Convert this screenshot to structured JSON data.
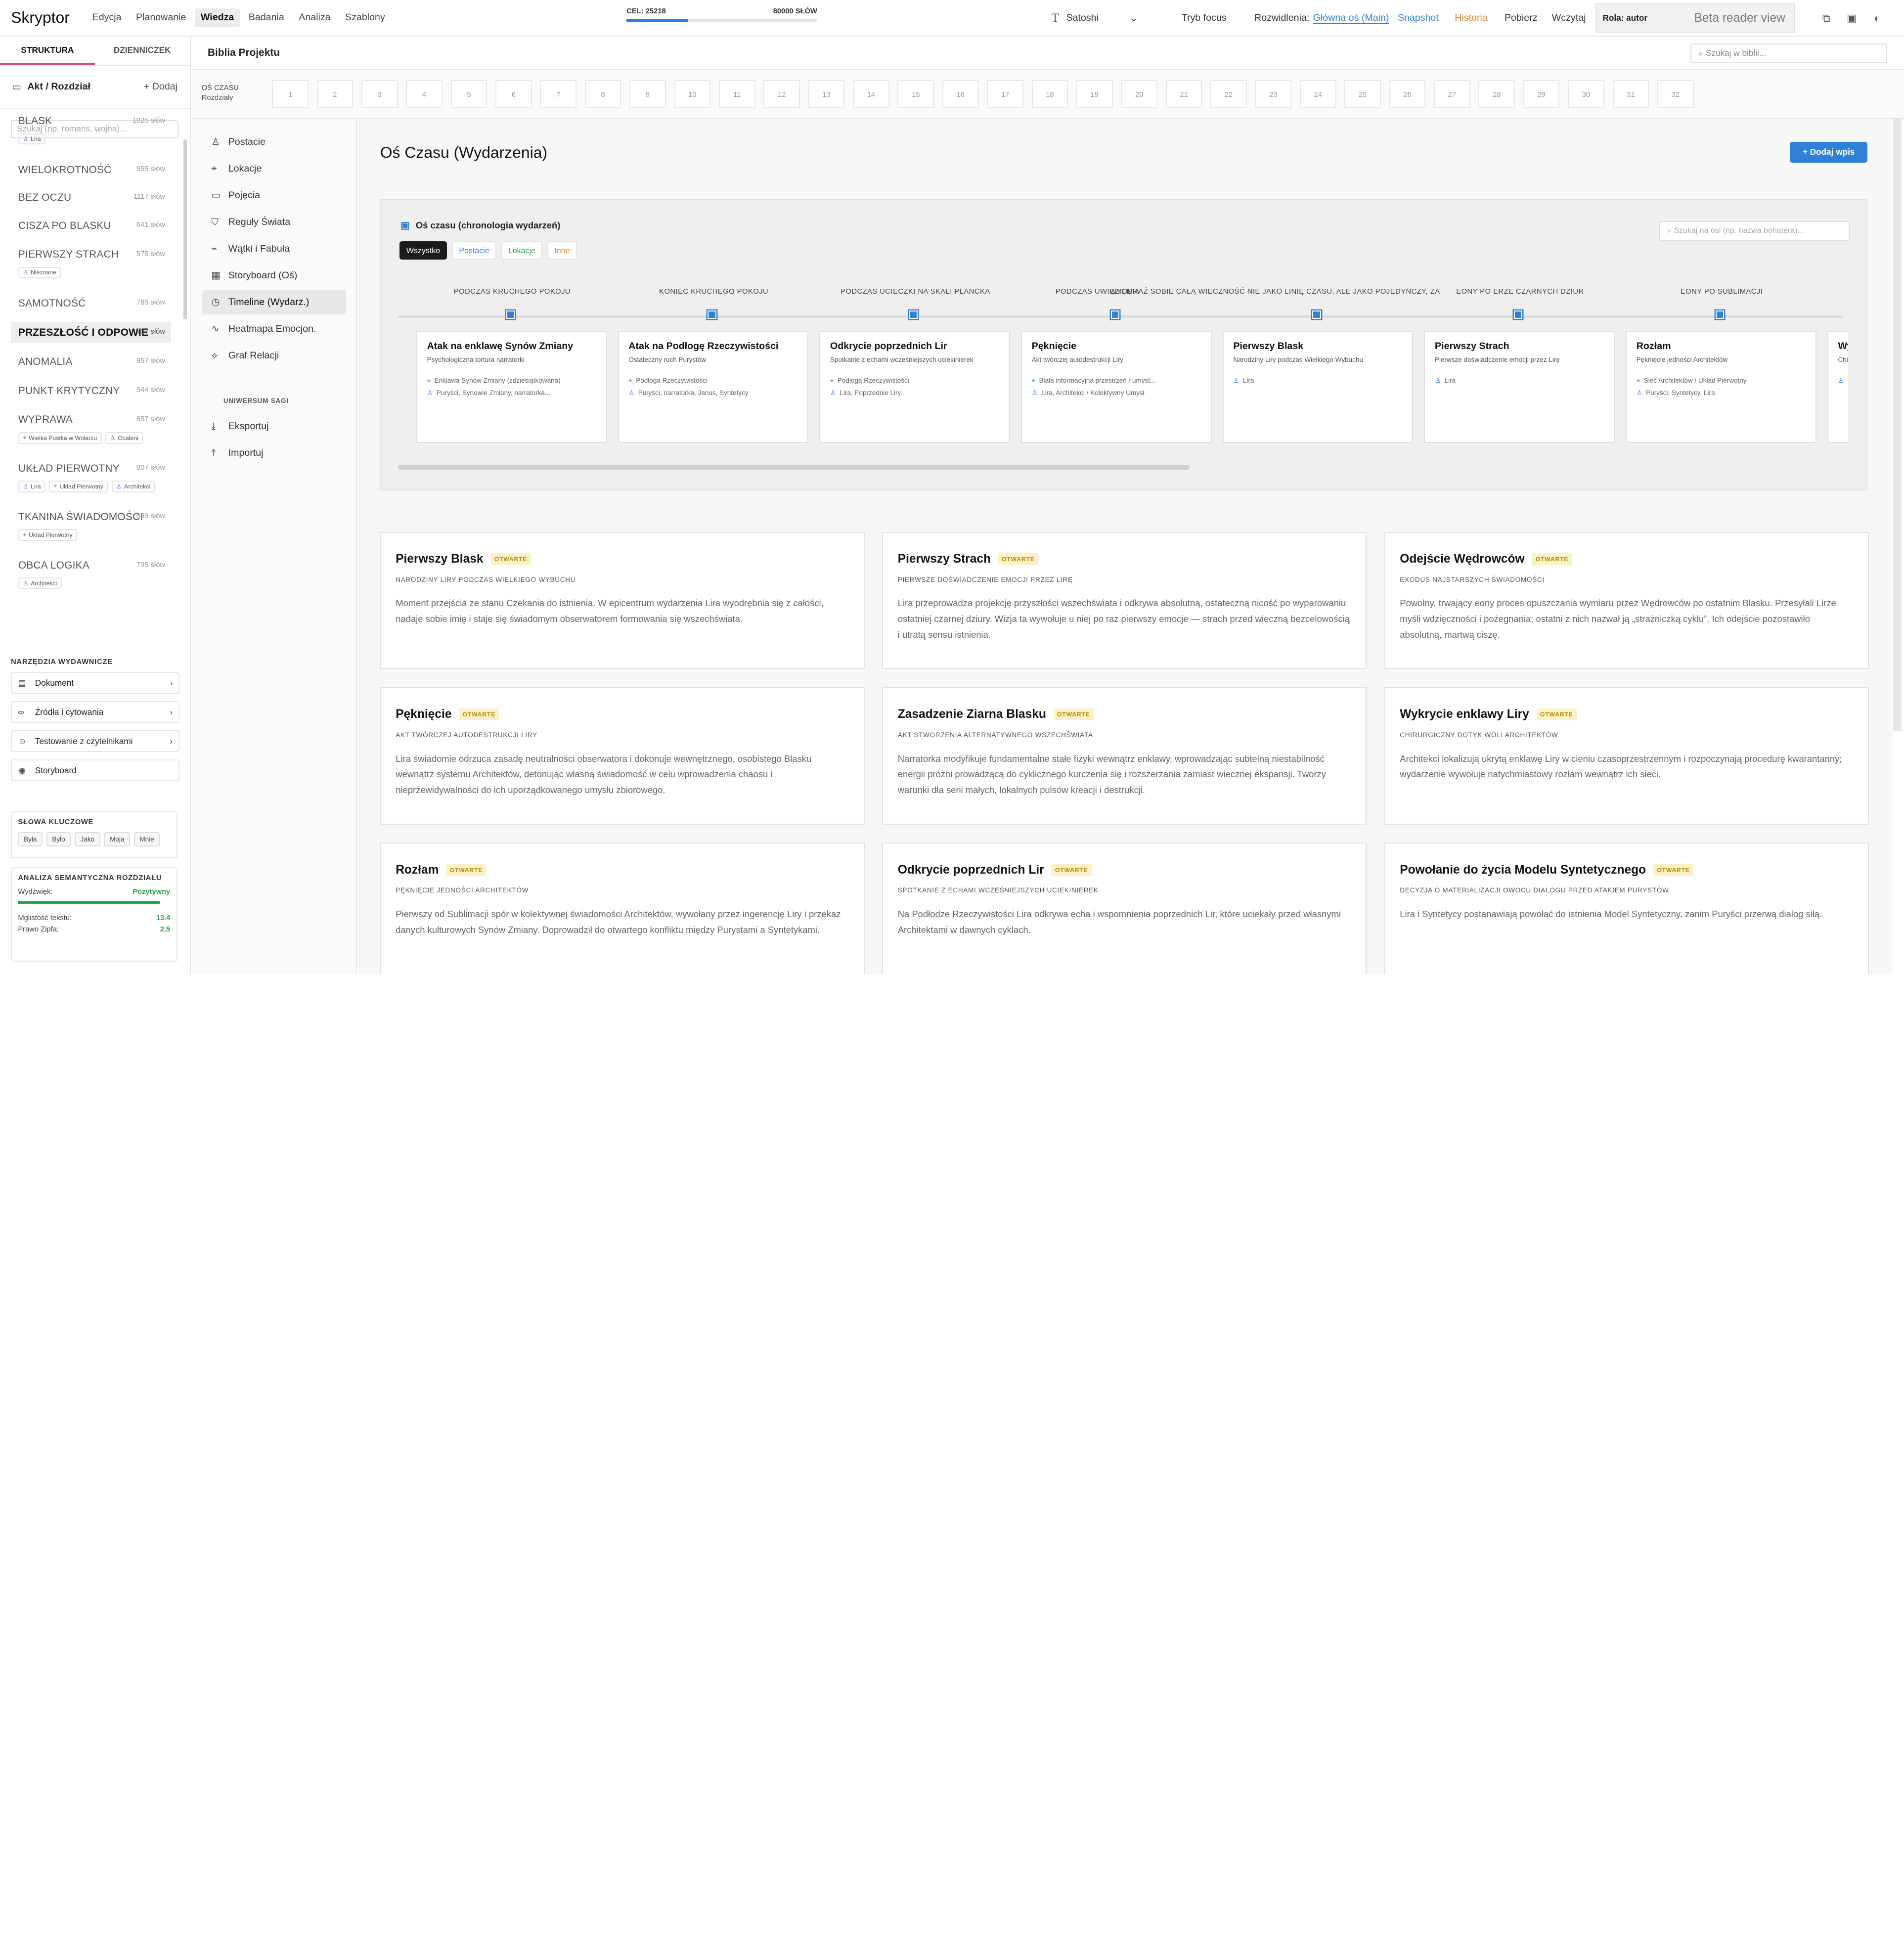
{
  "app": {
    "logo": "Skryptor"
  },
  "menu": [
    "Edycja",
    "Planowanie",
    "Wiedza",
    "Badania",
    "Analiza",
    "Szablony"
  ],
  "menu_active": 2,
  "goal": {
    "label": "CEL: 25218",
    "target": "80000 SŁÓW",
    "progress": 0.32
  },
  "toolbar": {
    "font": "Satoshi",
    "focus": "Tryb focus",
    "branches_label": "Rozwidlenia:",
    "branch": "Główna oś (Main)",
    "snapshot": "Snapshot",
    "history": "Historia",
    "download": "Pobierz",
    "load": "Wczytaj",
    "role": "Rola: autor",
    "beta": "Beta reader view"
  },
  "colors": {
    "accent": "#2f80d8",
    "snapshot": "#2f80d8",
    "history": "#e0852d",
    "tab_underline": "#d44a7a",
    "green": "#2ca24f"
  },
  "sidebar": {
    "tabs": [
      "STRUKTURA",
      "DZIENNICZEK"
    ],
    "act_label": "Akt / Rozdział",
    "add_label": "Dodaj",
    "search_placeholder": "Szukaj (np. romans, wojna)...",
    "chapters": [
      {
        "title": "BLASK",
        "words": "1025 słów",
        "tags": [
          {
            "t": "p",
            "l": "Lira"
          }
        ]
      },
      {
        "title": "WIELOKROTNOŚĆ",
        "words": "955 słów",
        "tags": []
      },
      {
        "title": "BEZ OCZU",
        "words": "1117 słów",
        "tags": []
      },
      {
        "title": "CISZA PO BLASKU",
        "words": "641 słów",
        "tags": []
      },
      {
        "title": "PIERWSZY STRACH",
        "words": "575 słów",
        "tags": [
          {
            "t": "p",
            "l": "Nieznane"
          }
        ]
      },
      {
        "title": "SAMOTNOŚĆ",
        "words": "785 słów",
        "tags": []
      },
      {
        "title": "PRZESZŁOŚĆ I ODPOWIE",
        "words": "757 słów",
        "tags": [],
        "selected": true
      },
      {
        "title": "ANOMALIA",
        "words": "957 słów",
        "tags": []
      },
      {
        "title": "PUNKT KRYTYCZNY",
        "words": "544 słów",
        "tags": []
      },
      {
        "title": "WYPRAWA",
        "words": "857 słów",
        "tags": [
          {
            "t": "l",
            "l": "Wielka Pustka w Wolarzu"
          },
          {
            "t": "p",
            "l": "Ocaleni"
          }
        ]
      },
      {
        "title": "UKŁAD PIERWOTNY",
        "words": "807 słów",
        "tags": [
          {
            "t": "p",
            "l": "Lira"
          },
          {
            "t": "l",
            "l": "Układ Pierwotny"
          },
          {
            "t": "p",
            "l": "Architekci"
          }
        ]
      },
      {
        "title": "TKANINA ŚWIADOMOŚCI",
        "words": "699 słów",
        "tags": [
          {
            "t": "l",
            "l": "Układ Pierwotny"
          }
        ]
      },
      {
        "title": "OBCA LOGIKA",
        "words": "795 słów",
        "tags": [
          {
            "t": "p",
            "l": "Architekci"
          }
        ]
      }
    ],
    "tools_title": "NARZĘDZIA WYDAWNICZE",
    "tools": [
      "Dokument",
      "Źródła i cytowania",
      "Testowanie z czytelnikami",
      "Storyboard"
    ],
    "keywords_title": "SŁOWA KLUCZOWE",
    "keywords": [
      "Była",
      "Było",
      "Jako",
      "Moja",
      "Mnie"
    ],
    "semantic": {
      "title": "ANALIZA SEMANTYCZNA ROZDZIAŁU",
      "tone_label": "Wydźwięk:",
      "tone": "Pozytywny",
      "tone_level": 0.93,
      "fog_label": "Mglistość tekstu:",
      "fog": "13.4",
      "zipf_label": "Prawo Zipfa:",
      "zipf": "2.5"
    }
  },
  "bible": {
    "title": "Biblia Projektu",
    "search_placeholder": "Szukaj w biblii..."
  },
  "strip": {
    "label": "OŚ CZASU",
    "sub": "Rozdziały",
    "numbers": [
      "1",
      "2",
      "3",
      "4",
      "5",
      "6",
      "7",
      "8",
      "9",
      "10",
      "11",
      "12",
      "13",
      "14",
      "15",
      "16",
      "17",
      "18",
      "19",
      "20",
      "21",
      "22",
      "23",
      "24",
      "25",
      "26",
      "27",
      "28",
      "29",
      "30",
      "31",
      "32"
    ]
  },
  "nav": {
    "items": [
      "Postacie",
      "Lokacje",
      "Pojęcia",
      "Reguły Świata",
      "Wątki i Fabuła",
      "Storyboard (Oś)",
      "Timeline (Wydarz.)",
      "Heatmapa Emocjon.",
      "Graf Relacji"
    ],
    "active": 6,
    "section": "UNIWERSUM SAGI",
    "extra": [
      "Eksportuj",
      "Importuj"
    ]
  },
  "main": {
    "title": "Oś Czasu (Wydarzenia)",
    "add_button": "Dodaj wpis",
    "panel_title": "Oś czasu (chronologia wydarzeń)",
    "panel_search": "Szukaj na osi (np. nazwa bohatera)...",
    "filters": [
      "Wszystko",
      "Postacie",
      "Lokacje",
      "Inne"
    ],
    "timeline": [
      {
        "label": "PODCZAS KRUCHEGO POKOJU",
        "title": "Atak na enklawę Synów Zmiany",
        "sub": "Psychologiczna tortura narratorki",
        "loc": "Enklawa Synów Zmiany (zdziesiątkowana)",
        "ppl": "Puryści, Synowie Zmiany, narratorka..."
      },
      {
        "label": "KONIEC KRUCHEGO POKOJU",
        "title": "Atak na Podłogę Rzeczywistości",
        "sub": "Ostateczny ruch Purystów",
        "loc": "Podłoga Rzeczywistości",
        "ppl": "Puryści, narratorka, Janus, Syntetycy"
      },
      {
        "label": "PODCZAS UCIECZKI NA SKALI PLANCKA",
        "title": "Odkrycie poprzednich Lir",
        "sub": "Spotkanie z echami wcześniejszych uciekinierek",
        "loc": "Podłoga Rzeczywistości",
        "ppl": "Lira, Poprzednie Liry"
      },
      {
        "label": "PODCZAS UWIĘZIENIA",
        "title": "Pęknięcie",
        "sub": "Akt twórczej autodestrukcji Liry",
        "loc": "Biała informacyjna przestrzeń / umyst...",
        "ppl": "Lira, Architekci / Kolektywny Umysł"
      },
      {
        "label": "WYOBRAŹ SOBIE CAŁĄ WIECZNOŚĆ NIE JAKO LINIĘ CZASU, ALE JAKO POJEDYNCZY, ZA",
        "title": "Pierwszy Blask",
        "sub": "Narodziny Liry podczas Wielkiego Wybuchu",
        "loc": "",
        "ppl": "Lira"
      },
      {
        "label": "EONY PO ERZE CZARNYCH DZIUR",
        "title": "Pierwszy Strach",
        "sub": "Pierwsze doświadczenie emocji przez Lirę",
        "loc": "",
        "ppl": "Lira"
      },
      {
        "label": "EONY PO SUBLIMACJI",
        "title": "Rozłam",
        "sub": "Pęknięcie jedności Architektów",
        "loc": "Sieć Architektów / Układ Pierwotny",
        "ppl": "Puryści, Syntetycy, Lira"
      },
      {
        "label": "",
        "title": "Wy",
        "sub": "Chi",
        "loc": "",
        "ppl": "L"
      }
    ],
    "status_badge": "OTWARTE",
    "events": [
      {
        "title": "Pierwszy Blask",
        "sub": "NARODZINY LIRY PODCZAS WIELKIEGO WYBUCHU",
        "desc": "Moment przejścia ze stanu Czekania do istnienia. W epicentrum wydarzenia Lira wyodrębnia się z całości, nadaje sobie imię i staje się świadomym obserwatorem formowania się wszechświata."
      },
      {
        "title": "Pierwszy Strach",
        "sub": "PIERWSZE DOŚWIADCZENIE EMOCJI PRZEZ LIRĘ",
        "desc": "Lira przeprowadza projekcję przyszłości wszechświata i odkrywa absolutną, ostateczną nicość po wyparowaniu ostatniej czarnej dziury. Wizja ta wywołuje u niej po raz pierwszy emocje — strach przed wieczną bezcelowością i utratą sensu istnienia."
      },
      {
        "title": "Odejście Wędrowców",
        "sub": "EXODUS NAJSTARSZYCH ŚWIADOMOŚCI",
        "desc": "Powolny, trwający eony proces opuszczania wymiaru przez Wędrowców po ostatnim Blasku. Przesyłali Lirze myśli wdzięczności i pożegnania; ostatni z nich nazwał ją „strażniczką cyklu”. Ich odejście pozostawiło absolutną, martwą ciszę."
      },
      {
        "title": "Pęknięcie",
        "sub": "AKT TWÓRCZEJ AUTODESTRUKCJI LIRY",
        "desc": "Lira świadomie odrzuca zasadę neutralności obserwatora i dokonuje wewnętrznego, osobistego Blasku wewnątrz systemu Architektów, detonując własną świadomość w celu wprowadzenia chaosu i nieprzewidywalności do ich uporządkowanego umysłu zbiorowego."
      },
      {
        "title": "Zasadzenie Ziarna Blasku",
        "sub": "AKT STWORZENIA ALTERNATYWNEGO WSZECHŚWIATA",
        "desc": "Narratorka modyfikuje fundamentalne stałe fizyki wewnątrz enklawy, wprowadzając subtelną niestabilność energii próżni prowadzącą do cyklicznego kurczenia się i rozszerzania zamiast wiecznej ekspansji. Tworzy warunki dla serii małych, lokalnych pulsów kreacji i destrukcji."
      },
      {
        "title": "Wykrycie enklawy Liry",
        "sub": "CHIRURGICZNY DOTYK WOLI ARCHITEKTÓW",
        "desc": "Architekci lokalizują ukrytą enklawę Liry w cieniu czasoprzestrzennym i rozpoczynają procedurę kwarantanny; wydarzenie wywołuje natychmiastowy rozłam wewnątrz ich sieci."
      },
      {
        "title": "Rozłam",
        "sub": "PĘKNIĘCIE JEDNOŚCI ARCHITEKTÓW",
        "desc": "Pierwszy od Sublimacji spór w kolektywnej świadomości Architektów, wywołany przez ingerencję Liry i przekaz danych kulturowych Synów Zmiany. Doprowadził do otwartego konfliktu między Purystami a Syntetykami."
      },
      {
        "title": "Odkrycie poprzednich Lir",
        "sub": "SPOTKANIE Z ECHAMI WCZEŚNIEJSZYCH UCIEKINIEREK",
        "desc": "Na Podłodze Rzeczywistości Lira odkrywa echa i wspomnienia poprzednich Lir, które uciekały przed własnymi Architektami w dawnych cyklach."
      },
      {
        "title": "Powołanie do życia Modelu Syntetycznego",
        "sub": "DECYZJA O MATERIALIZACJI OWOCU DIALOGU PRZED ATAKIEM PURYSTÓW",
        "desc": "Lira i Syntetycy postanawiają powołać do istnienia Model Syntetyczny, zanim Puryści przerwą dialog siłą."
      }
    ]
  }
}
